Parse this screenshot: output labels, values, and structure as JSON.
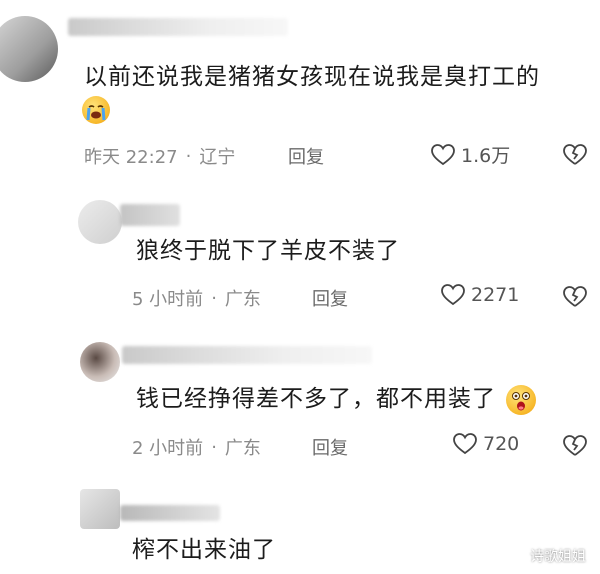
{
  "comments": [
    {
      "text": "以前还说我是猪猪女孩现在说我是臭打工的",
      "emoji": "loudly-crying-face",
      "time": "昨天 22:27",
      "location": "辽宁",
      "reply_label": "回复",
      "likes": "1.6万"
    },
    {
      "text": "狼终于脱下了羊皮不装了",
      "time": "5 小时前",
      "location": "广东",
      "reply_label": "回复",
      "likes": "2271"
    },
    {
      "text": "钱已经挣得差不多了，都不用装了",
      "emoji": "surprised-face",
      "time": "2 小时前",
      "location": "广东",
      "reply_label": "回复",
      "likes": "720"
    },
    {
      "text": "榨不出来油了"
    }
  ],
  "separator": "·",
  "watermark": "诗歌姐姐",
  "colors": {
    "meta": "#8a8a8a",
    "text": "#1c1c1c"
  }
}
